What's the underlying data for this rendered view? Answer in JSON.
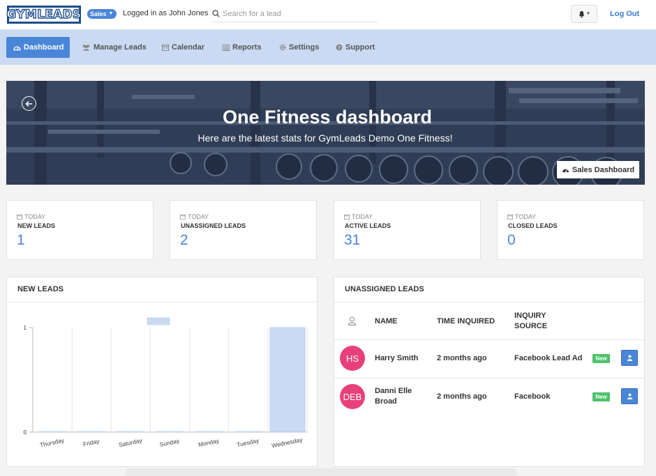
{
  "header": {
    "logo_text": "GYMLEADS",
    "role_badge": "Sales",
    "logged_in_text": "Logged in as John Jones",
    "search_placeholder": "Search for a lead",
    "logout_label": "Log Out"
  },
  "nav": {
    "items": [
      {
        "label": "Dashboard",
        "icon": "dashboard-icon",
        "active": true
      },
      {
        "label": "Manage Leads",
        "icon": "users-icon"
      },
      {
        "label": "Calendar",
        "icon": "calendar-icon"
      },
      {
        "label": "Reports",
        "icon": "list-icon"
      },
      {
        "label": "Settings",
        "icon": "gear-icon"
      },
      {
        "label": "Support",
        "icon": "question-icon"
      }
    ]
  },
  "hero": {
    "title": "One Fitness dashboard",
    "subtitle": "Here are the latest stats for GymLeads Demo One Fitness!",
    "button_label": "Sales Dashboard"
  },
  "stats": [
    {
      "period": "TODAY",
      "label": "NEW LEADS",
      "value": "1"
    },
    {
      "period": "TODAY",
      "label": "UNASSIGNED LEADS",
      "value": "2"
    },
    {
      "period": "TODAY",
      "label": "ACTIVE LEADS",
      "value": "31"
    },
    {
      "period": "TODAY",
      "label": "CLOSED LEADS",
      "value": "0"
    }
  ],
  "new_leads_panel": {
    "title": "NEW LEADS"
  },
  "chart_data": {
    "type": "bar",
    "title": "",
    "categories": [
      "Thursday",
      "Friday",
      "Saturday",
      "Sunday",
      "Monday",
      "Tuesday",
      "Wednesday"
    ],
    "values": [
      0,
      0,
      0,
      0,
      0,
      0,
      1
    ],
    "yticks": [
      "0",
      "1"
    ],
    "ylim": [
      0,
      1
    ],
    "legend": "top-center",
    "bar_color": "#c9daf2"
  },
  "unassigned_panel": {
    "title": "UNASSIGNED LEADS",
    "columns": {
      "name": "NAME",
      "time": "TIME INQUIRED",
      "source_line1": "INQUIRY",
      "source_line2": "SOURCE"
    },
    "rows": [
      {
        "initials": "HS",
        "name_line1": "Harry Smith",
        "name_line2": "",
        "time": "2 months ago",
        "source": "Facebook Lead Ad",
        "badge": "New"
      },
      {
        "initials": "DEB",
        "name_line1": "Danni Elle",
        "name_line2": "Broad",
        "time": "2 months ago",
        "source": "Facebook",
        "badge": "New"
      }
    ]
  },
  "colors": {
    "accent": "#4a86d8",
    "nav_bg": "#c9daf2",
    "avatar": "#e8407a",
    "badge_green": "#4cc26a"
  }
}
